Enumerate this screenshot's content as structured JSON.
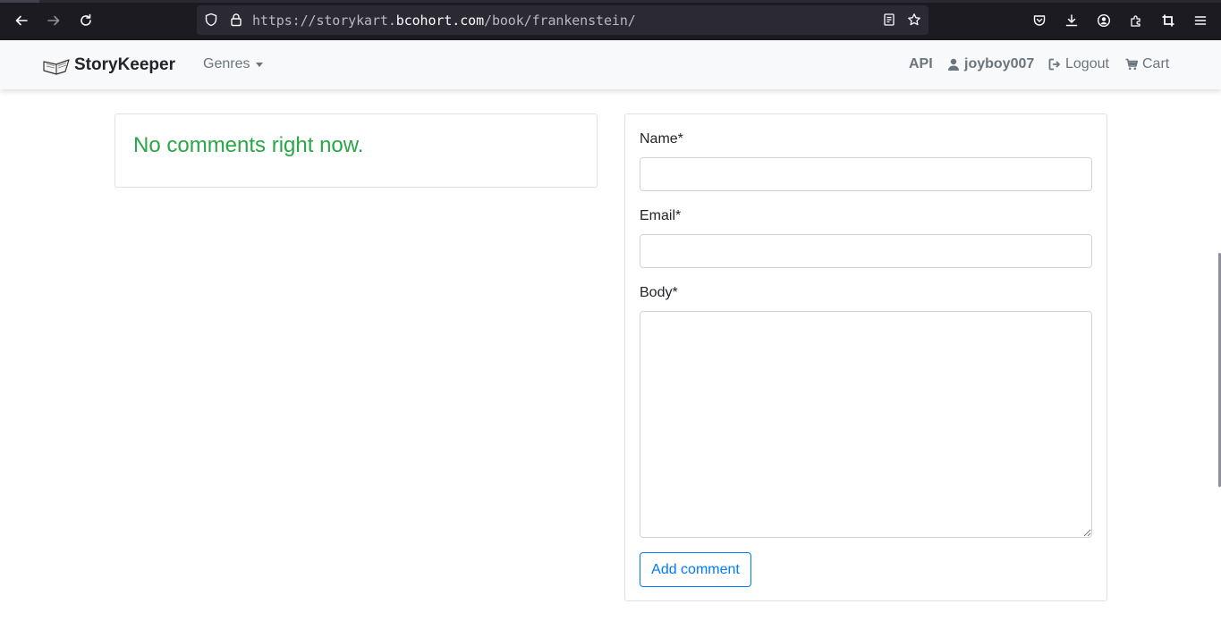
{
  "browser": {
    "url_prefix": "https://storykart.",
    "url_domain": "bcohort.com",
    "url_path": "/book/frankenstein/",
    "icons": [
      "back-icon",
      "forward-icon",
      "reload-icon",
      "shield-icon",
      "lock-icon",
      "reader-view-icon",
      "bookmark-star-icon",
      "pocket-icon",
      "download-icon",
      "account-icon",
      "extensions-icon",
      "crop-icon",
      "menu-icon"
    ]
  },
  "navbar": {
    "brand": "StoryKeeper",
    "genres": "Genres",
    "api": "API",
    "user": "joyboy007",
    "logout": "Logout",
    "cart": "Cart"
  },
  "comments": {
    "empty_message": "No comments right now."
  },
  "form": {
    "name_label": "Name*",
    "name_value": "",
    "email_label": "Email*",
    "email_value": "",
    "body_label": "Body*",
    "body_value": "",
    "submit_label": "Add comment"
  },
  "colors": {
    "success": "#28a745",
    "primary": "#007bff",
    "browser_bg": "#1c1b22",
    "navbar_bg": "#f8f9fa"
  }
}
